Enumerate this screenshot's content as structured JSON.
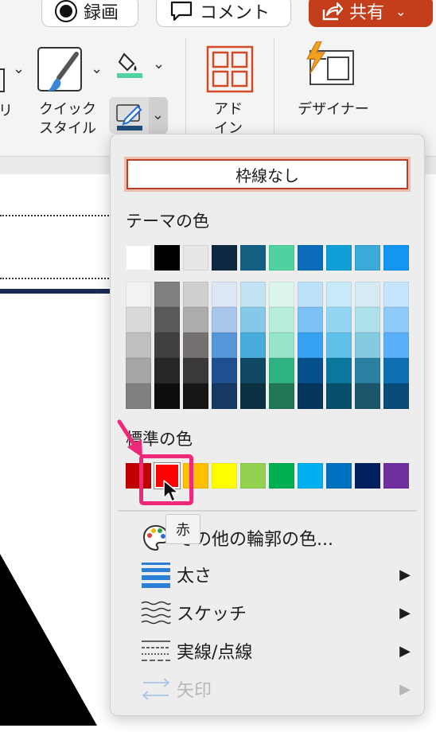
{
  "toolbar": {
    "record_label": "録画",
    "comment_label": "コメント",
    "share_label": "共有"
  },
  "ribbon": {
    "quick_style_label_1": "クイック",
    "quick_style_label_2": "スタイル",
    "addin_label_1": "アド",
    "addin_label_2": "イン",
    "designer_label": "デザイナー",
    "partial_left_label": "リ"
  },
  "menu": {
    "no_outline": "枠線なし",
    "theme_colors_title": "テーマの色",
    "standard_colors_title": "標準の色",
    "theme_top_row": [
      "#ffffff",
      "#000000",
      "#e7e6e6",
      "#0e2841",
      "#156082",
      "#4fd1a0",
      "#0a6bba",
      "#0f9ed5",
      "#3aaad8",
      "#1296f0"
    ],
    "theme_shades": [
      [
        "#f2f2f2",
        "#d9d9d9",
        "#bfbfbf",
        "#a6a6a6",
        "#808080"
      ],
      [
        "#7f7f7f",
        "#595959",
        "#404040",
        "#262626",
        "#0d0d0d"
      ],
      [
        "#d0cece",
        "#aeabab",
        "#757171",
        "#3a3838",
        "#171616"
      ],
      [
        "#dce6f5",
        "#a9c5ea",
        "#5596d9",
        "#1f4f8f",
        "#153963"
      ],
      [
        "#c2e3f3",
        "#85c8e8",
        "#48acdb",
        "#104863",
        "#0b3042"
      ],
      [
        "#dcf6ee",
        "#b8eddc",
        "#95e4cb",
        "#2fb382",
        "#1f7756"
      ],
      [
        "#bde0fb",
        "#7bc1f6",
        "#38a2f2",
        "#06508c",
        "#03355d"
      ],
      [
        "#c8eaf8",
        "#94d6f1",
        "#5fc1ea",
        "#0a779f",
        "#064f6a"
      ],
      [
        "#d6eaf4",
        "#ade0e9",
        "#84cbdf",
        "#2a80a1",
        "#1c566b"
      ],
      [
        "#c7e4fd",
        "#90cafb",
        "#58affa",
        "#0c70b3",
        "#084b78"
      ]
    ],
    "standard_colors": [
      "#c00000",
      "#ff0000",
      "#ffc000",
      "#ffff00",
      "#92d050",
      "#00b050",
      "#00b0f0",
      "#0070c0",
      "#002060",
      "#7030a0"
    ],
    "tooltip": "赤",
    "more_colors": "その他の輪郭の色...",
    "weight": "太さ",
    "sketch": "スケッチ",
    "dashes": "実線/点線",
    "arrows": "矢印",
    "submenu_arrow": "▶"
  },
  "colors": {
    "accent_share": "#c43e1c",
    "highlight": "#f0287b",
    "pen_underline": "#1f4e79",
    "fill_underline": "#4fd1a0"
  },
  "icons": [
    "record-icon",
    "comment-icon",
    "share-icon",
    "quick-style-icon",
    "fill-bucket-icon",
    "pen-icon",
    "addin-icon",
    "designer-icon",
    "palette-icon",
    "weight-icon",
    "sketch-icon",
    "dash-icon",
    "arrow-icon",
    "cursor-icon"
  ]
}
